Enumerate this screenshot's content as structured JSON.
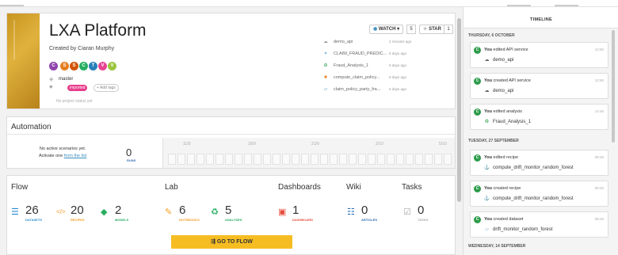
{
  "project": {
    "title": "LXA Platform",
    "created_by": "Created by Ciaran Murphy",
    "branch": "master",
    "tag": "imported",
    "add_tag": "+ Add tags",
    "status": "No project status yet",
    "watch_label": "WATCH",
    "watch_count": "5",
    "star_label": "STAR",
    "star_count": "1",
    "avatars": [
      {
        "letter": "C",
        "color": "#8e44ad"
      },
      {
        "letter": "S",
        "color": "#e67e22"
      },
      {
        "letter": "S",
        "color": "#d35400"
      },
      {
        "letter": "C",
        "color": "#27ae60"
      },
      {
        "letter": "T",
        "color": "#2980b9"
      },
      {
        "letter": "V",
        "color": "#e84393"
      },
      {
        "letter": "V",
        "color": "#9bc53d"
      }
    ]
  },
  "activity": [
    {
      "icon": "cloud-icon",
      "glyph": "☁",
      "color": "#999",
      "name": "demo_api",
      "time": "2 minutes ago"
    },
    {
      "icon": "sparkle-icon",
      "glyph": "✦",
      "color": "#5aa0c8",
      "name": "CLAIM_FRAUD_PREDIC...",
      "time": "5 days ago"
    },
    {
      "icon": "recycle-icon",
      "glyph": "♻",
      "color": "#2c9b4a",
      "name": "Fraud_Analysis_1",
      "time": "5 days ago"
    },
    {
      "icon": "gear-icon",
      "glyph": "✹",
      "color": "#e67e22",
      "name": "compute_claim_policy...",
      "time": "6 days ago"
    },
    {
      "icon": "folder-icon",
      "glyph": "▱",
      "color": "#5aa0c8",
      "name": "claim_policy_party_fra...",
      "time": "6 days ago"
    }
  ],
  "automation": {
    "title": "Automation",
    "no_active": "No active scenarios yet.",
    "activate_prefix": "Activate one",
    "activate_link": "from the list",
    "runs_num": "0",
    "runs_label": "RUNS",
    "dates": [
      "11/9",
      "16/9",
      "21/9",
      "2/10",
      "5/10"
    ]
  },
  "sections": {
    "flow": "Flow",
    "lab": "Lab",
    "dashboards": "Dashboards",
    "wiki": "Wiki",
    "tasks": "Tasks"
  },
  "stats": [
    {
      "key": "datasets",
      "num": "26",
      "label": "DATASETS",
      "color": "#2b8ccf",
      "glyph": "☰"
    },
    {
      "key": "recipes",
      "num": "20",
      "label": "RECIPES",
      "color": "#f29c1f",
      "glyph": "</>"
    },
    {
      "key": "models",
      "num": "2",
      "label": "MODELS",
      "color": "#27ae60",
      "glyph": "◆"
    },
    {
      "key": "notebooks",
      "num": "6",
      "label": "NOTEBOOKS",
      "color": "#f29c1f",
      "glyph": "✎"
    },
    {
      "key": "analyses",
      "num": "5",
      "label": "ANALYSES",
      "color": "#27ae60",
      "glyph": "♻"
    },
    {
      "key": "dashboard",
      "num": "1",
      "label": "DASHBOARD",
      "color": "#e74c3c",
      "glyph": "▣"
    },
    {
      "key": "articles",
      "num": "0",
      "label": "ARTICLES",
      "color": "#2b6cb0",
      "glyph": "☷"
    },
    {
      "key": "tasks",
      "num": "0",
      "label": "TASKS",
      "color": "#aaaaaa",
      "glyph": "☑"
    }
  ],
  "go_to_flow": "GO TO FLOW",
  "timeline": {
    "title": "TIMELINE",
    "days": [
      "THURSDAY, 6 OCTOBER",
      "TUESDAY, 27 SEPTEMBER",
      "WEDNESDAY, 14 SEPTEMBER"
    ],
    "events": [
      {
        "who": "You",
        "action": "edited API service",
        "time": "12:50",
        "icon": "cloud-icon",
        "glyph": "☁",
        "color": "#666",
        "object": "demo_api"
      },
      {
        "who": "You",
        "action": "created API service",
        "time": "12:50",
        "icon": "cloud-icon",
        "glyph": "☁",
        "color": "#666",
        "object": "demo_api"
      },
      {
        "who": "You",
        "action": "edited analysis",
        "time": "12:46",
        "icon": "recycle-icon",
        "glyph": "♻",
        "color": "#2c9b4a",
        "object": "Fraud_Analysis_1"
      },
      {
        "who": "You",
        "action": "edited recipe",
        "time": "09:20",
        "icon": "anchor-icon",
        "glyph": "⚓",
        "color": "#c0392b",
        "object": "compute_drift_monitor_random_forest"
      },
      {
        "who": "You",
        "action": "created recipe",
        "time": "09:20",
        "icon": "anchor-icon",
        "glyph": "⚓",
        "color": "#c0392b",
        "object": "compute_drift_monitor_random_forest"
      },
      {
        "who": "You",
        "action": "created dataset",
        "time": "09:20",
        "icon": "folder-icon",
        "glyph": "▱",
        "color": "#5aa0c8",
        "object": "drift_monitor_random_forest"
      }
    ]
  }
}
